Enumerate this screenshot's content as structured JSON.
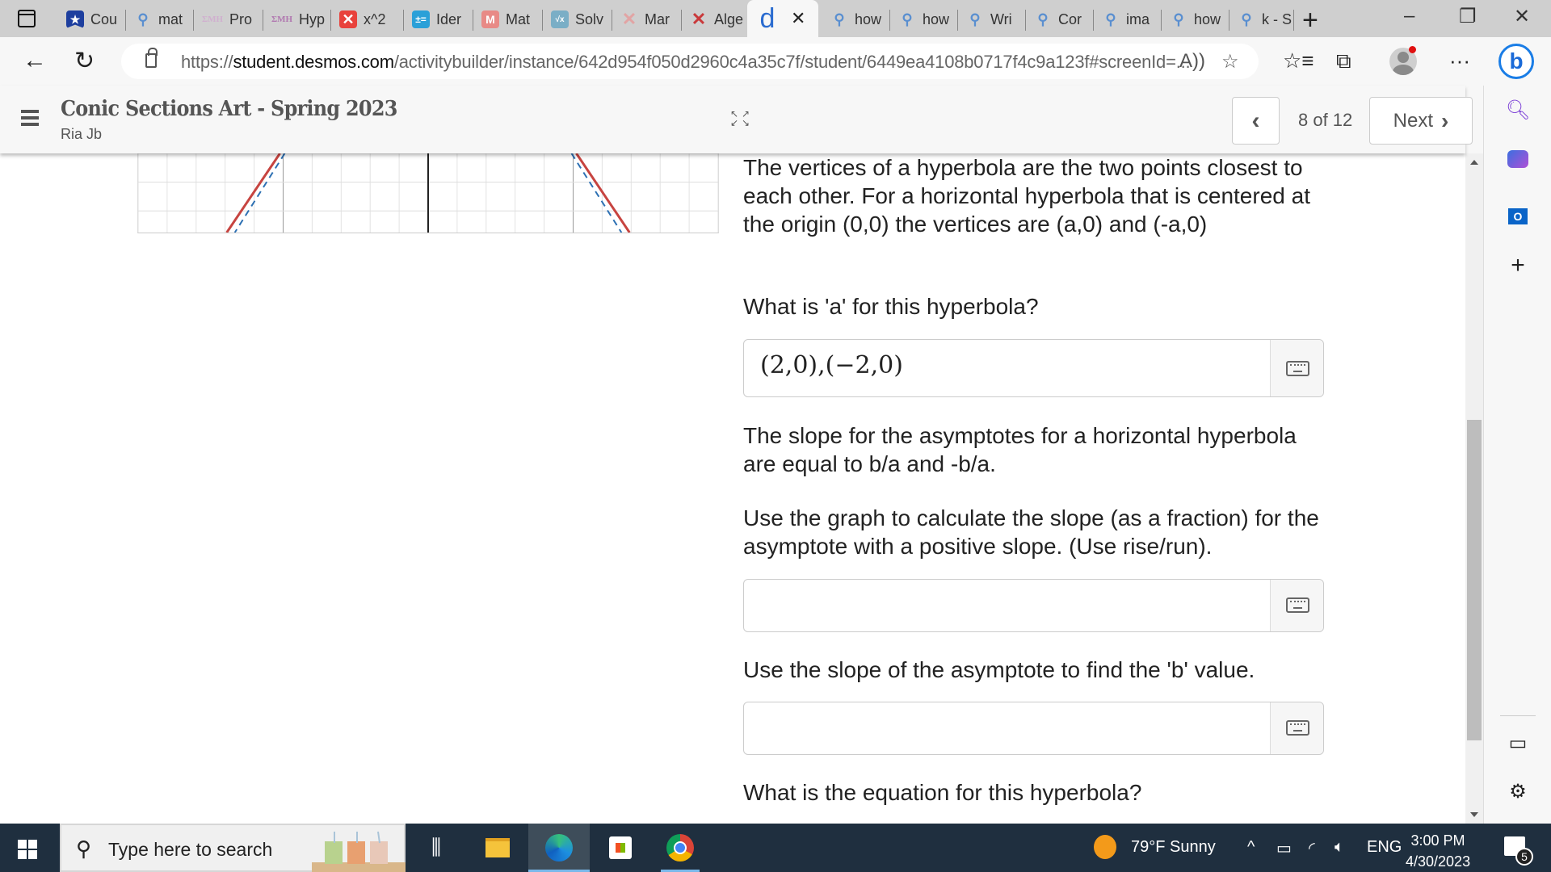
{
  "browser": {
    "tabs": [
      {
        "label": "Cou",
        "icon": "bookmark-star-icon"
      },
      {
        "label": "mat",
        "icon": "search-icon"
      },
      {
        "label": "Pro",
        "icon": "imh-icon"
      },
      {
        "label": "Hyp",
        "icon": "imh-icon"
      },
      {
        "label": "x^2",
        "icon": "red-x-icon"
      },
      {
        "label": "Ider",
        "icon": "calculator-icon"
      },
      {
        "label": "Mat",
        "icon": "mathway-icon"
      },
      {
        "label": "Solv",
        "icon": "sqrt-icon"
      },
      {
        "label": "Mar",
        "icon": "desmos-x-icon"
      },
      {
        "label": "Alge",
        "icon": "desmos-x-icon"
      },
      {
        "label": "how",
        "icon": "search-icon"
      },
      {
        "label": "how",
        "icon": "search-icon"
      },
      {
        "label": "Wri",
        "icon": "search-icon"
      },
      {
        "label": "Cor",
        "icon": "search-icon"
      },
      {
        "label": "ima",
        "icon": "search-icon"
      },
      {
        "label": "how",
        "icon": "search-icon"
      },
      {
        "label": "k - S",
        "icon": "search-icon"
      }
    ],
    "active_tab": {
      "icon_text": "d",
      "close": "✕"
    },
    "new_tab": "+",
    "window_controls": {
      "minimize": "–",
      "maximize": "❐",
      "close": "✕"
    },
    "url_prefix": "https://",
    "url_domain": "student.desmos.com",
    "url_path": "/activitybuilder/instance/642d954f050d2960c4a35c7f/student/6449ea4108b0717f4c9a123f#screenId=...",
    "read_aloud": "A))",
    "more": "···",
    "bing_label": "b"
  },
  "app": {
    "title": "Conic Sections Art - Spring 2023",
    "student": "Ria Jb",
    "page_indicator": "8 of 12",
    "prev_label": "‹",
    "next_label": "Next",
    "next_chevron": "›"
  },
  "content": {
    "p1": "The vertices of a hyperbola are the two points closest to each other.  For a horizontal hyperbola that is centered at the origin (0,0) the vertices are (a,0) and (-a,0)",
    "q1": "What is 'a' for this hyperbola?",
    "answer1": "(2,0),(−2,0)",
    "p2": "The slope for the asymptotes for a horizontal hyperbola are equal to b/a and -b/a.",
    "q2": "Use the graph to calculate the slope (as a fraction) for the asymptote with a positive slope.  (Use rise/run).",
    "answer2": "",
    "q3": "Use the slope of the asymptote to find the 'b' value.",
    "answer3": "",
    "q4": "What is the equation for this hyperbola?",
    "graph_colors": {
      "hyperbola": "#c74440",
      "asymptote": "#2d70b3"
    }
  },
  "sidebar": {
    "add": "+"
  },
  "taskbar": {
    "search_placeholder": "Type here to search",
    "weather": "79°F  Sunny",
    "language": "ENG",
    "time": "3:00 PM",
    "date": "4/30/2023",
    "notifications": "5",
    "tray_up": "^"
  }
}
